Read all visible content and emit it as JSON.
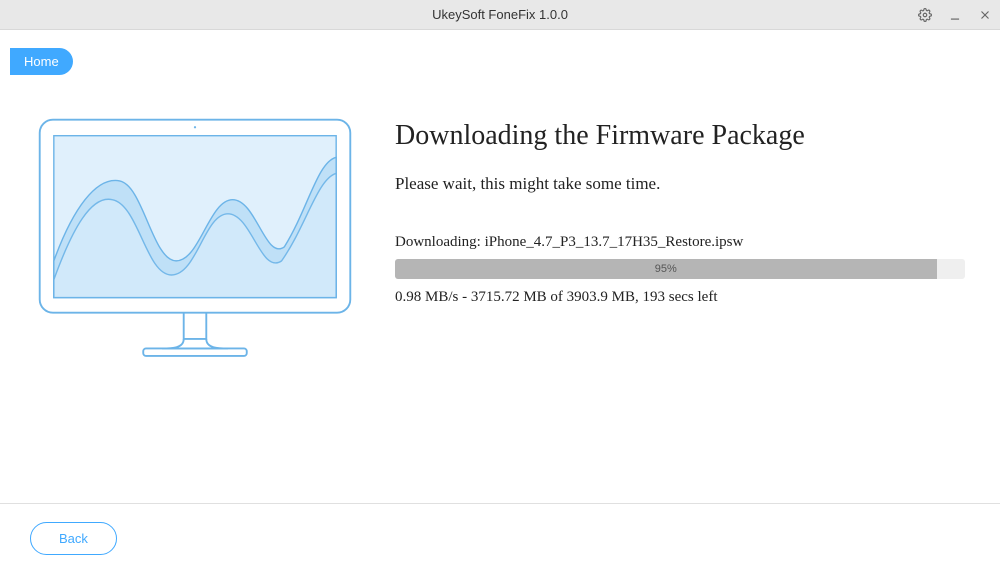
{
  "titlebar": {
    "title": "UkeySoft FoneFix 1.0.0"
  },
  "home_button": "Home",
  "download": {
    "heading": "Downloading the Firmware Package",
    "subtitle": "Please wait, this might take some time.",
    "file_label": "Downloading: iPhone_4.7_P3_13.7_17H35_Restore.ipsw",
    "progress_pct": "95%",
    "progress_width": "95%",
    "stats": "0.98 MB/s - 3715.72 MB of 3903.9 MB, 193 secs left"
  },
  "footer": {
    "back": "Back"
  }
}
